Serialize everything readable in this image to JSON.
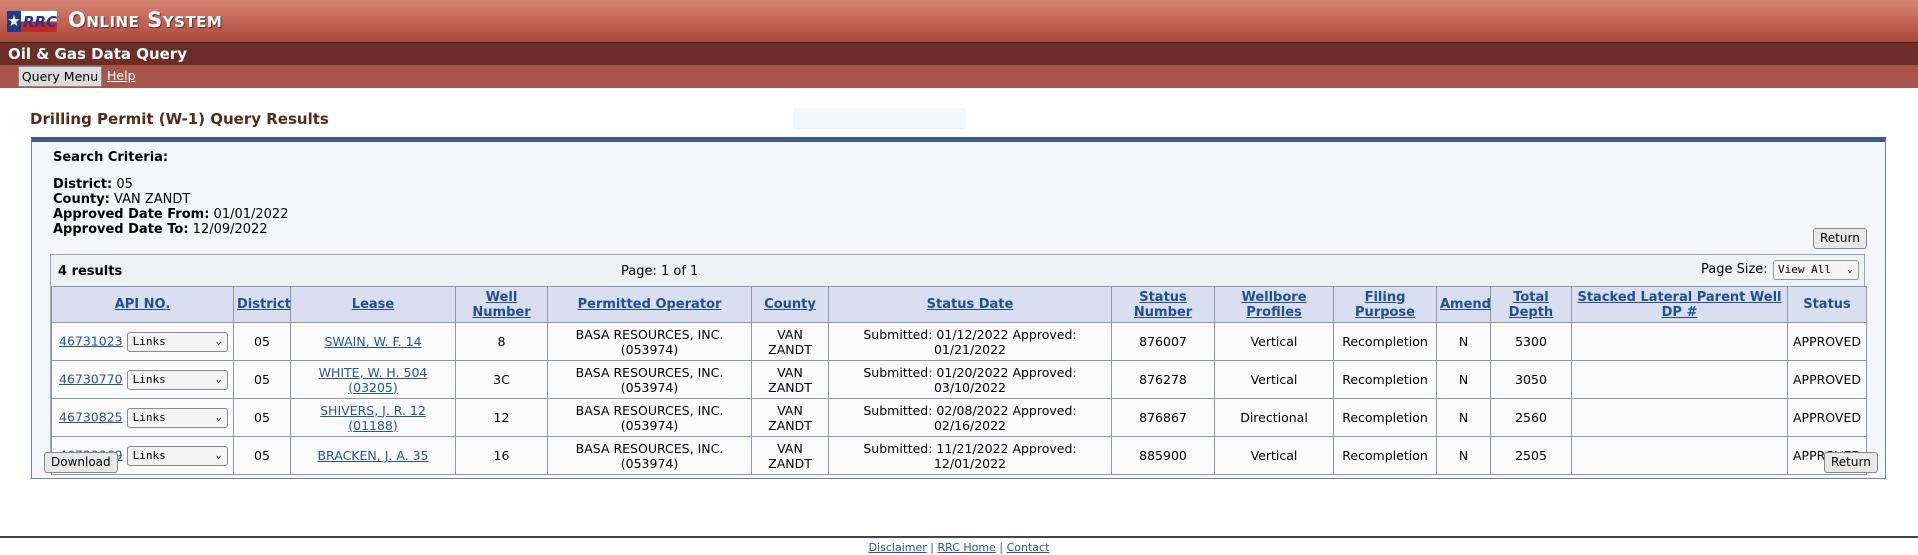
{
  "header": {
    "logo_text": "RRC",
    "system_title": "Online System",
    "app_title": "Oil & Gas Data Query",
    "nav": {
      "query_menu": "Query Menu",
      "help": "Help"
    }
  },
  "page_title": "Drilling Permit (W-1) Query Results",
  "criteria": {
    "heading": "Search Criteria:",
    "items": [
      {
        "label": "District:",
        "value": "05"
      },
      {
        "label": "County:",
        "value": "VAN ZANDT"
      },
      {
        "label": "Approved Date From:",
        "value": "01/01/2022"
      },
      {
        "label": "Approved Date To:",
        "value": "12/09/2022"
      }
    ]
  },
  "buttons": {
    "return": "Return",
    "download": "Download"
  },
  "results": {
    "count": "4 results",
    "page_info": "Page: 1 of 1",
    "page_size_label": "Page Size:",
    "page_size_value": "View All"
  },
  "table": {
    "columns": [
      "API NO.",
      "District",
      "Lease",
      "Well Number",
      "Permitted Operator",
      "County",
      "Status Date",
      "Status Number",
      "Wellbore Profiles",
      "Filing Purpose",
      "Amend",
      "Total Depth",
      "Stacked Lateral Parent Well DP #",
      "Status"
    ],
    "rows": [
      {
        "api": "46731023",
        "links": "Links",
        "district": "05",
        "lease": "SWAIN, W. F. 14",
        "well": "8",
        "operator": "BASA RESOURCES, INC.(053974)",
        "county": "VAN ZANDT",
        "status_date": "Submitted: 01/12/2022 Approved: 01/21/2022",
        "status_number": "876007",
        "profile": "Vertical",
        "purpose": "Recompletion",
        "amend": "N",
        "depth": "5300",
        "stacked": "",
        "status": "APPROVED"
      },
      {
        "api": "46730770",
        "links": "Links",
        "district": "05",
        "lease": "WHITE, W. H. 504 (03205)",
        "well": "3C",
        "operator": "BASA RESOURCES, INC.(053974)",
        "county": "VAN ZANDT",
        "status_date": "Submitted: 01/20/2022 Approved: 03/10/2022",
        "status_number": "876278",
        "profile": "Vertical",
        "purpose": "Recompletion",
        "amend": "N",
        "depth": "3050",
        "stacked": "",
        "status": "APPROVED"
      },
      {
        "api": "46730825",
        "links": "Links",
        "district": "05",
        "lease": "SHIVERS, J. R. 12 (01188)",
        "well": "12",
        "operator": "BASA RESOURCES, INC.(053974)",
        "county": "VAN ZANDT",
        "status_date": "Submitted: 02/08/2022 Approved: 02/16/2022",
        "status_number": "876867",
        "profile": "Directional",
        "purpose": "Recompletion",
        "amend": "N",
        "depth": "2560",
        "stacked": "",
        "status": "APPROVED"
      },
      {
        "api": "46730969",
        "links": "Links",
        "district": "05",
        "lease": "BRACKEN, J. A. 35",
        "well": "16",
        "operator": "BASA RESOURCES, INC.(053974)",
        "county": "VAN ZANDT",
        "status_date": "Submitted: 11/21/2022 Approved: 12/01/2022",
        "status_number": "885900",
        "profile": "Vertical",
        "purpose": "Recompletion",
        "amend": "N",
        "depth": "2505",
        "stacked": "",
        "status": "APPROVED"
      }
    ]
  },
  "footer": {
    "links": [
      "Disclaimer",
      "RRC Home",
      "Contact"
    ],
    "separator": "|"
  },
  "colors": {
    "header_dark": "#6b2e26",
    "header_nav": "#a9554b",
    "link": "#2255a4",
    "panel_border": "#3e5a8a"
  }
}
